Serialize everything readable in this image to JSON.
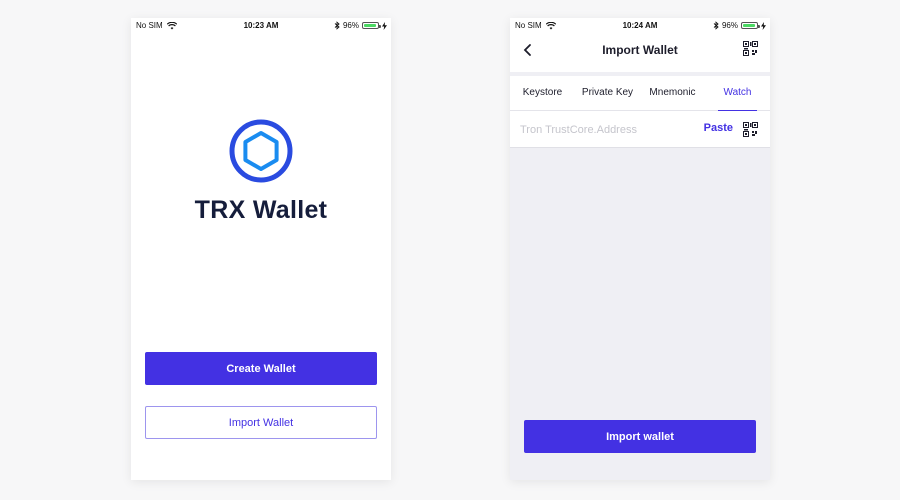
{
  "status_left": {
    "carrier": "No SIM",
    "time": "10:23 AM",
    "battery": "96%",
    "battery_level": 0.96
  },
  "status_right": {
    "carrier": "No SIM",
    "time": "10:24 AM",
    "battery": "96%",
    "battery_level": 0.96
  },
  "welcome": {
    "app_name": "TRX Wallet",
    "create_label": "Create Wallet",
    "import_label": "Import Wallet"
  },
  "import": {
    "title": "Import Wallet",
    "tabs": [
      {
        "label": "Keystore",
        "active": false
      },
      {
        "label": "Private Key",
        "active": false
      },
      {
        "label": "Mnemonic",
        "active": false
      },
      {
        "label": "Watch",
        "active": true
      }
    ],
    "address_placeholder": "Tron TrustCore.Address",
    "address_value": "",
    "paste_label": "Paste",
    "submit_label": "Import wallet"
  },
  "colors": {
    "accent": "#4331e3",
    "logo_ring": "#2a4be0",
    "logo_hex": "#1a8cf0",
    "battery": "#4cd964"
  },
  "icons": [
    "wifi-icon",
    "bluetooth-icon",
    "battery-icon",
    "charging-icon",
    "back-chevron-icon",
    "qr-code-icon",
    "hexagon-logo"
  ]
}
